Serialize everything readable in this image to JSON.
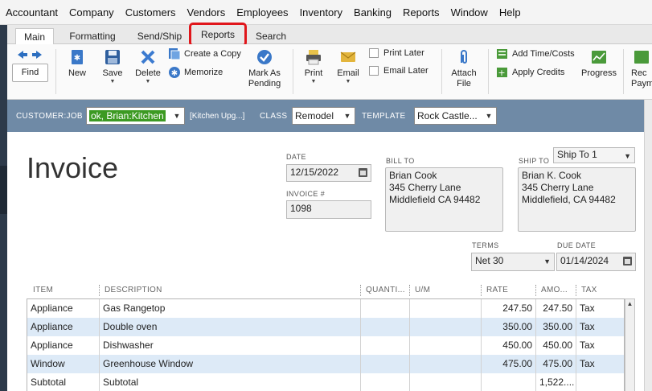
{
  "menu": [
    "Accountant",
    "Company",
    "Customers",
    "Vendors",
    "Employees",
    "Inventory",
    "Banking",
    "Reports",
    "Window",
    "Help"
  ],
  "tabs": {
    "main": "Main",
    "formatting": "Formatting",
    "sendship": "Send/Ship",
    "reports": "Reports",
    "search": "Search"
  },
  "toolbar": {
    "find": "Find",
    "new": "New",
    "save": "Save",
    "delete": "Delete",
    "create_copy": "Create a Copy",
    "memorize": "Memorize",
    "mark_as": "Mark As",
    "pending": "Pending",
    "print": "Print",
    "email": "Email",
    "print_later": "Print Later",
    "email_later": "Email Later",
    "attach": "Attach",
    "file": "File",
    "add_time_costs": "Add Time/Costs",
    "apply_credits": "Apply Credits",
    "progress": "Progress",
    "receive_1": "Rec",
    "receive_2": "Paym"
  },
  "customer_bar": {
    "customer_job_label": "CUSTOMER:JOB",
    "customer_job_value": "ok, Brian:Kitchen",
    "customer_job_note": "[Kitchen Upg...]",
    "class_label": "CLASS",
    "class_value": "Remodel",
    "template_label": "TEMPLATE",
    "template_value": "Rock Castle..."
  },
  "invoice": {
    "title": "Invoice",
    "date_label": "DATE",
    "date_value": "12/15/2022",
    "invoice_no_label": "INVOICE #",
    "invoice_no_value": "1098",
    "bill_to_label": "BILL TO",
    "bill_to_lines": [
      "Brian Cook",
      "345 Cherry Lane",
      "Middlefield CA 94482"
    ],
    "ship_to_label": "SHIP TO",
    "ship_to_select": "Ship To 1",
    "ship_to_lines": [
      "Brian K. Cook",
      "345 Cherry Lane",
      "Middlefield, CA 94482"
    ],
    "terms_label": "TERMS",
    "terms_value": "Net 30",
    "due_date_label": "DUE DATE",
    "due_date_value": "01/14/2024"
  },
  "table": {
    "headers": [
      "ITEM",
      "DESCRIPTION",
      "QUANTI...",
      "U/M",
      "RATE",
      "AMO...",
      "TAX"
    ],
    "rows": [
      {
        "item": "Appliance",
        "description": "Gas Rangetop",
        "qty": "",
        "um": "",
        "rate": "247.50",
        "amount": "247.50",
        "tax": "Tax"
      },
      {
        "item": "Appliance",
        "description": "Double oven",
        "qty": "",
        "um": "",
        "rate": "350.00",
        "amount": "350.00",
        "tax": "Tax"
      },
      {
        "item": "Appliance",
        "description": "Dishwasher",
        "qty": "",
        "um": "",
        "rate": "450.00",
        "amount": "450.00",
        "tax": "Tax"
      },
      {
        "item": "Window",
        "description": "Greenhouse Window",
        "qty": "",
        "um": "",
        "rate": "475.00",
        "amount": "475.00",
        "tax": "Tax"
      },
      {
        "item": "Subtotal",
        "description": "Subtotal",
        "qty": "",
        "um": "",
        "rate": "",
        "amount": "1,522....",
        "tax": ""
      }
    ]
  },
  "colors": {
    "customer_bar": "#6f8aa6",
    "highlight_box": "#e0161b",
    "job_selection": "#3c9a22",
    "row_alt": "#ddeaf7"
  }
}
